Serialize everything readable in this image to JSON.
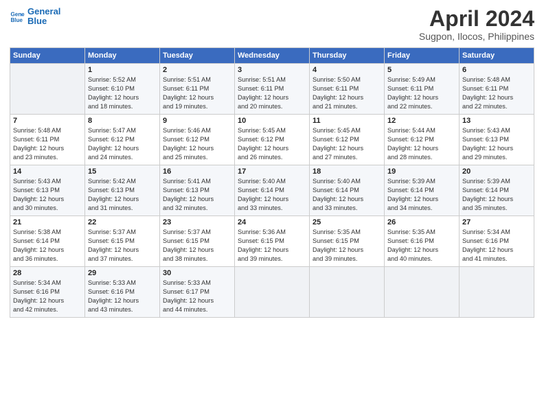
{
  "header": {
    "logo_line1": "General",
    "logo_line2": "Blue",
    "title": "April 2024",
    "subtitle": "Sugpon, Ilocos, Philippines"
  },
  "weekdays": [
    "Sunday",
    "Monday",
    "Tuesday",
    "Wednesday",
    "Thursday",
    "Friday",
    "Saturday"
  ],
  "weeks": [
    [
      {
        "day": "",
        "info": ""
      },
      {
        "day": "1",
        "info": "Sunrise: 5:52 AM\nSunset: 6:10 PM\nDaylight: 12 hours\nand 18 minutes."
      },
      {
        "day": "2",
        "info": "Sunrise: 5:51 AM\nSunset: 6:11 PM\nDaylight: 12 hours\nand 19 minutes."
      },
      {
        "day": "3",
        "info": "Sunrise: 5:51 AM\nSunset: 6:11 PM\nDaylight: 12 hours\nand 20 minutes."
      },
      {
        "day": "4",
        "info": "Sunrise: 5:50 AM\nSunset: 6:11 PM\nDaylight: 12 hours\nand 21 minutes."
      },
      {
        "day": "5",
        "info": "Sunrise: 5:49 AM\nSunset: 6:11 PM\nDaylight: 12 hours\nand 22 minutes."
      },
      {
        "day": "6",
        "info": "Sunrise: 5:48 AM\nSunset: 6:11 PM\nDaylight: 12 hours\nand 22 minutes."
      }
    ],
    [
      {
        "day": "7",
        "info": "Sunrise: 5:48 AM\nSunset: 6:11 PM\nDaylight: 12 hours\nand 23 minutes."
      },
      {
        "day": "8",
        "info": "Sunrise: 5:47 AM\nSunset: 6:12 PM\nDaylight: 12 hours\nand 24 minutes."
      },
      {
        "day": "9",
        "info": "Sunrise: 5:46 AM\nSunset: 6:12 PM\nDaylight: 12 hours\nand 25 minutes."
      },
      {
        "day": "10",
        "info": "Sunrise: 5:45 AM\nSunset: 6:12 PM\nDaylight: 12 hours\nand 26 minutes."
      },
      {
        "day": "11",
        "info": "Sunrise: 5:45 AM\nSunset: 6:12 PM\nDaylight: 12 hours\nand 27 minutes."
      },
      {
        "day": "12",
        "info": "Sunrise: 5:44 AM\nSunset: 6:12 PM\nDaylight: 12 hours\nand 28 minutes."
      },
      {
        "day": "13",
        "info": "Sunrise: 5:43 AM\nSunset: 6:13 PM\nDaylight: 12 hours\nand 29 minutes."
      }
    ],
    [
      {
        "day": "14",
        "info": "Sunrise: 5:43 AM\nSunset: 6:13 PM\nDaylight: 12 hours\nand 30 minutes."
      },
      {
        "day": "15",
        "info": "Sunrise: 5:42 AM\nSunset: 6:13 PM\nDaylight: 12 hours\nand 31 minutes."
      },
      {
        "day": "16",
        "info": "Sunrise: 5:41 AM\nSunset: 6:13 PM\nDaylight: 12 hours\nand 32 minutes."
      },
      {
        "day": "17",
        "info": "Sunrise: 5:40 AM\nSunset: 6:14 PM\nDaylight: 12 hours\nand 33 minutes."
      },
      {
        "day": "18",
        "info": "Sunrise: 5:40 AM\nSunset: 6:14 PM\nDaylight: 12 hours\nand 33 minutes."
      },
      {
        "day": "19",
        "info": "Sunrise: 5:39 AM\nSunset: 6:14 PM\nDaylight: 12 hours\nand 34 minutes."
      },
      {
        "day": "20",
        "info": "Sunrise: 5:39 AM\nSunset: 6:14 PM\nDaylight: 12 hours\nand 35 minutes."
      }
    ],
    [
      {
        "day": "21",
        "info": "Sunrise: 5:38 AM\nSunset: 6:14 PM\nDaylight: 12 hours\nand 36 minutes."
      },
      {
        "day": "22",
        "info": "Sunrise: 5:37 AM\nSunset: 6:15 PM\nDaylight: 12 hours\nand 37 minutes."
      },
      {
        "day": "23",
        "info": "Sunrise: 5:37 AM\nSunset: 6:15 PM\nDaylight: 12 hours\nand 38 minutes."
      },
      {
        "day": "24",
        "info": "Sunrise: 5:36 AM\nSunset: 6:15 PM\nDaylight: 12 hours\nand 39 minutes."
      },
      {
        "day": "25",
        "info": "Sunrise: 5:35 AM\nSunset: 6:15 PM\nDaylight: 12 hours\nand 39 minutes."
      },
      {
        "day": "26",
        "info": "Sunrise: 5:35 AM\nSunset: 6:16 PM\nDaylight: 12 hours\nand 40 minutes."
      },
      {
        "day": "27",
        "info": "Sunrise: 5:34 AM\nSunset: 6:16 PM\nDaylight: 12 hours\nand 41 minutes."
      }
    ],
    [
      {
        "day": "28",
        "info": "Sunrise: 5:34 AM\nSunset: 6:16 PM\nDaylight: 12 hours\nand 42 minutes."
      },
      {
        "day": "29",
        "info": "Sunrise: 5:33 AM\nSunset: 6:16 PM\nDaylight: 12 hours\nand 43 minutes."
      },
      {
        "day": "30",
        "info": "Sunrise: 5:33 AM\nSunset: 6:17 PM\nDaylight: 12 hours\nand 44 minutes."
      },
      {
        "day": "",
        "info": ""
      },
      {
        "day": "",
        "info": ""
      },
      {
        "day": "",
        "info": ""
      },
      {
        "day": "",
        "info": ""
      }
    ]
  ]
}
